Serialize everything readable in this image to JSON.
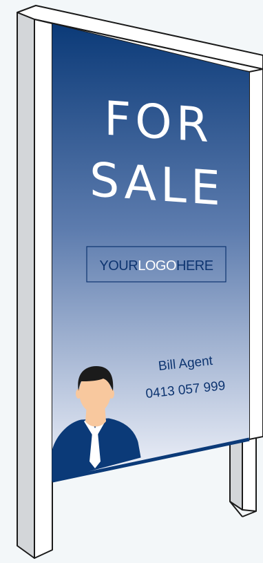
{
  "sign": {
    "headline_line1": "FOR",
    "headline_line2": "SALE",
    "logo_part1": "YOUR",
    "logo_part2": "LOGO",
    "logo_part3": "HERE",
    "agent_name": "Bill Agent",
    "agent_phone": "0413 057 999"
  },
  "colors": {
    "background": "#f3f7f9",
    "board_top": "#0b3a78",
    "board_bottom": "#f2f4fb",
    "post_face": "#ffffff",
    "post_side": "#d3d6d9",
    "outline": "#1a1a1a",
    "logo_dark": "#0d3470",
    "logo_light": "#ffffff"
  }
}
